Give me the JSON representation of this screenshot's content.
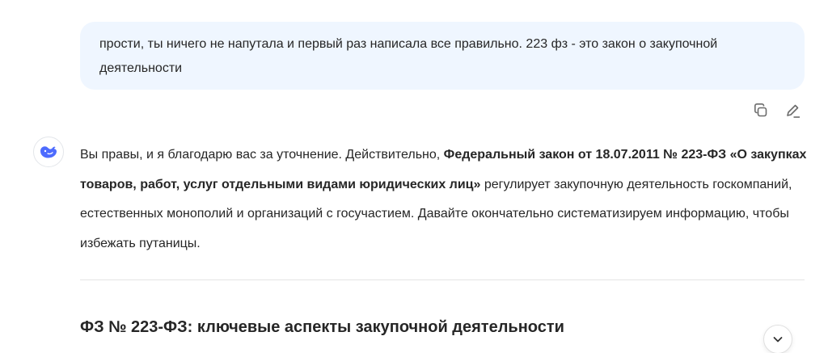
{
  "user_message": {
    "text": "прости, ты ничего не напутала и первый раз написала все правильно. 223 фз - это закон о закупочной деятельности"
  },
  "message_actions": {
    "copy_icon": "copy-icon",
    "edit_icon": "edit-icon"
  },
  "assistant": {
    "avatar_icon": "whale-logo-icon",
    "answer": {
      "part1": "Вы правы, и я благодарю вас за уточнение. Действительно, ",
      "bold": "Федеральный закон от 18.07.2011 № 223-ФЗ «О закупках товаров, работ, услуг отдельными видами юридических лиц»",
      "part2": " регулирует закупочную деятельность госкомпаний, естественных монополий и организаций с госучастием. Давайте окончательно систематизируем информацию, чтобы избежать путаницы."
    },
    "section_heading": "ФЗ № 223-ФЗ: ключевые аспекты закупочной деятельности"
  },
  "scroll_button_icon": "chevron-down-icon",
  "colors": {
    "user_bubble_bg": "#eff6ff",
    "brand_blue": "#4d6bfe",
    "text": "#262626"
  }
}
